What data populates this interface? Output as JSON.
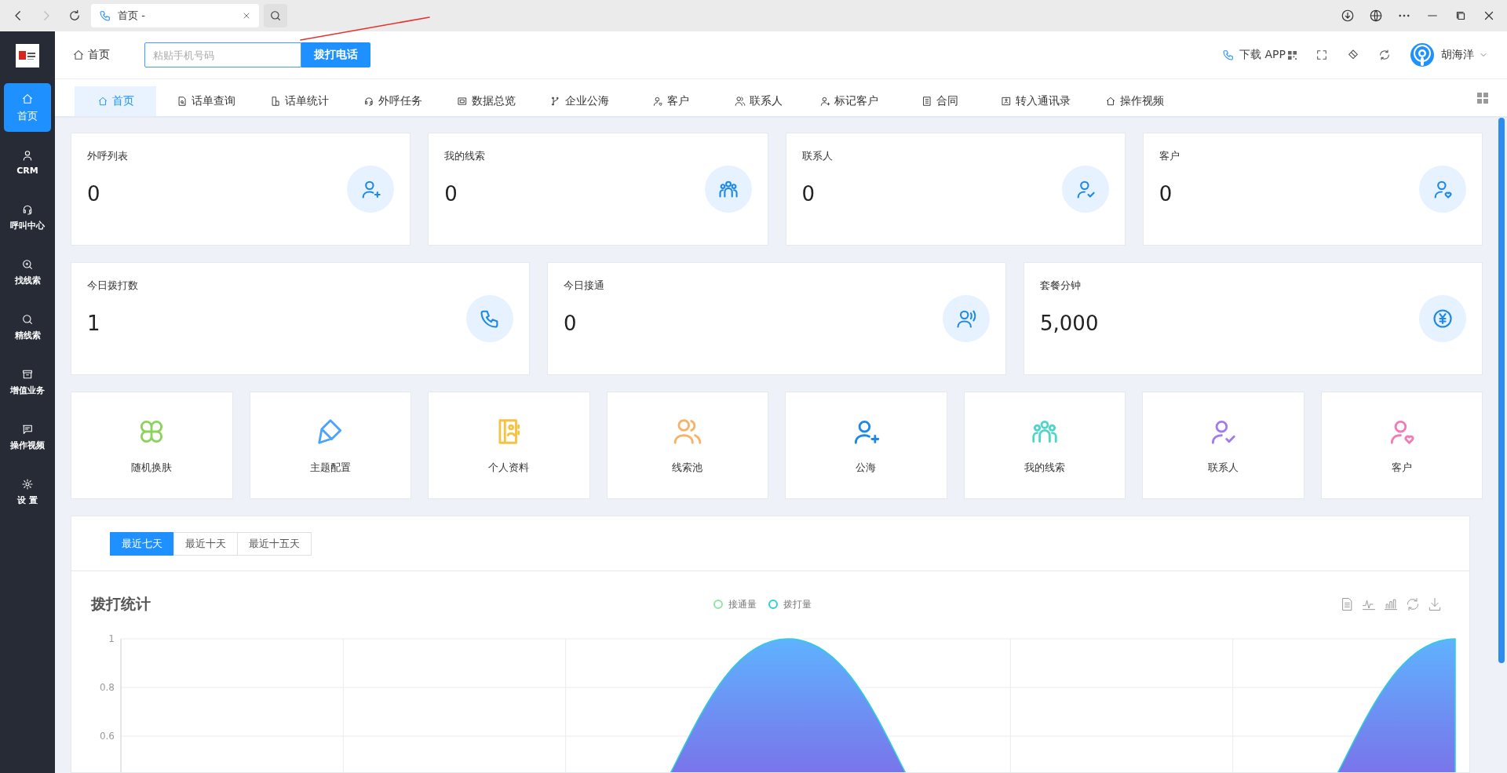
{
  "browser": {
    "tab_title": "首页 -"
  },
  "sidebar": {
    "items": [
      {
        "label": "首页",
        "selected": true
      },
      {
        "label": "CRM",
        "selected": false
      },
      {
        "label": "呼叫中心",
        "selected": false
      },
      {
        "label": "找线索",
        "selected": false
      },
      {
        "label": "精线索",
        "selected": false
      },
      {
        "label": "增值业务",
        "selected": false
      },
      {
        "label": "操作视频",
        "selected": false
      },
      {
        "label": "设 置",
        "selected": false
      }
    ]
  },
  "header": {
    "breadcrumb": "首页",
    "phone_field": {
      "placeholder": "粘贴手机号码"
    },
    "call_button": "拨打电话",
    "download_link": "下载 APP",
    "user_name": "胡海洋"
  },
  "tabs": [
    {
      "label": "首页",
      "selected": true
    },
    {
      "label": "话单查询",
      "selected": false
    },
    {
      "label": "话单统计",
      "selected": false
    },
    {
      "label": "外呼任务",
      "selected": false
    },
    {
      "label": "数据总览",
      "selected": false
    },
    {
      "label": "企业公海",
      "selected": false
    },
    {
      "label": "客户",
      "selected": false
    },
    {
      "label": "联系人",
      "selected": false
    },
    {
      "label": "标记客户",
      "selected": false
    },
    {
      "label": "合同",
      "selected": false
    },
    {
      "label": "转入通讯录",
      "selected": false
    },
    {
      "label": "操作视频",
      "selected": false
    }
  ],
  "stat_cards": [
    {
      "label": "外呼列表",
      "value": "0"
    },
    {
      "label": "我的线索",
      "value": "0"
    },
    {
      "label": "联系人",
      "value": "0"
    },
    {
      "label": "客户",
      "value": "0"
    }
  ],
  "stat_cards_wide": [
    {
      "label": "今日拨打数",
      "value": "1"
    },
    {
      "label": "今日接通",
      "value": "0"
    },
    {
      "label": "套餐分钟",
      "value": "5,000"
    }
  ],
  "shortcuts": [
    {
      "label": "随机换肤",
      "color": "#8bd35a"
    },
    {
      "label": "主题配置",
      "color": "#4aa3ff"
    },
    {
      "label": "个人资料",
      "color": "#f5c342"
    },
    {
      "label": "线索池",
      "color": "#f7b267"
    },
    {
      "label": "公海",
      "color": "#1e88e5"
    },
    {
      "label": "我的线索",
      "color": "#4dd6c8"
    },
    {
      "label": "联系人",
      "color": "#a07cf0"
    },
    {
      "label": "客户",
      "color": "#f47ab4"
    }
  ],
  "stats_panel": {
    "ranges": [
      {
        "label": "最近七天",
        "selected": true
      },
      {
        "label": "最近十天",
        "selected": false
      },
      {
        "label": "最近十五天",
        "selected": false
      }
    ],
    "title": "拨打统计",
    "chart_data": {
      "type": "area",
      "ylim": [
        0,
        1
      ],
      "yticks": [
        0.6,
        0.8,
        1
      ],
      "grid": true,
      "series": [
        {
          "name": "接通量",
          "color": "#8ee5a5",
          "values": [
            null,
            null,
            null,
            null,
            null,
            null,
            null
          ]
        },
        {
          "name": "拨打量",
          "color": "#2ad0dc",
          "values": [
            0,
            0,
            0,
            1,
            0,
            0,
            1
          ]
        }
      ]
    }
  }
}
